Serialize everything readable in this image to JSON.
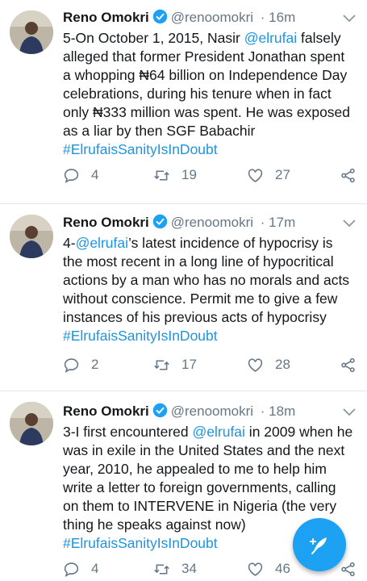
{
  "colors": {
    "accent": "#1da1f2",
    "link": "#1b95e0",
    "muted": "#657786"
  },
  "tweets": [
    {
      "name": "Reno Omokri",
      "handle": "@renoomokri",
      "time": "· 16m",
      "text": [
        {
          "t": "5-On October 1, 2015, Nasir "
        },
        {
          "t": "@elrufai",
          "link": true
        },
        {
          "t": " falsely alleged that former President Jonathan spent a whopping ₦64 billion on Independence Day celebrations, during his tenure when in fact only ₦333 million was spent. He was exposed as a liar by then SGF Babachir "
        },
        {
          "t": "#ElrufaisSanityIsInDoubt",
          "link": true
        }
      ],
      "replies": "4",
      "retweets": "19",
      "likes": "27"
    },
    {
      "name": "Reno Omokri",
      "handle": "@renoomokri",
      "time": "· 17m",
      "text": [
        {
          "t": "4-"
        },
        {
          "t": "@elrufai",
          "link": true
        },
        {
          "t": "’s latest incidence of hypocrisy is the most recent in a long line of hypocritical actions by a man who has no morals and acts without conscience. Permit me to give a few instances of his previous acts of hypocrisy "
        },
        {
          "t": "#ElrufaisSanityIsInDoubt",
          "link": true
        }
      ],
      "replies": "2",
      "retweets": "17",
      "likes": "28"
    },
    {
      "name": "Reno Omokri",
      "handle": "@renoomokri",
      "time": "· 18m",
      "text": [
        {
          "t": "3-I first encountered "
        },
        {
          "t": "@elrufai",
          "link": true
        },
        {
          "t": " in 2009 when he was in exile in the United States and the next year, 2010, he appealed to me to help him write a letter to foreign governments, calling on them to INTERVENE in Nigeria (the very thing he speaks against now) "
        },
        {
          "t": "#ElrufaisSanityIsInDoubt",
          "link": true
        }
      ],
      "replies": "4",
      "retweets": "34",
      "likes": "46"
    }
  ]
}
